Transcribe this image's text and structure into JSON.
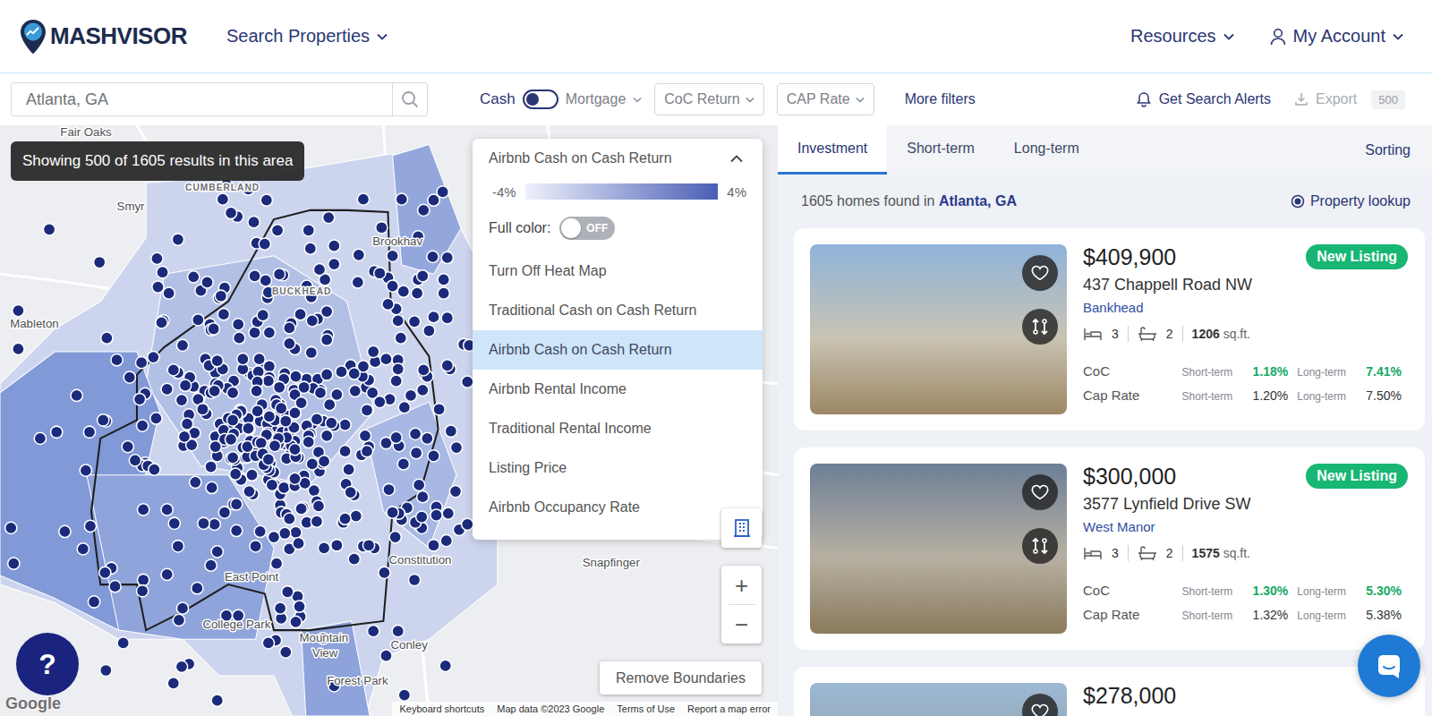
{
  "header": {
    "logo": "MASHVISOR",
    "menu": [
      {
        "label": "Search Properties"
      }
    ],
    "actions": [
      {
        "label": "Resources",
        "kind": "menu"
      },
      {
        "label": "My Account",
        "kind": "account"
      }
    ]
  },
  "filters": {
    "search": "Atlanta, GA",
    "cash": "Cash",
    "mortgage": "Mortgage",
    "mortgage_on": false,
    "selects": [
      "CoC Return",
      "CAP Rate"
    ],
    "more": "More filters",
    "alerts": "Get Search Alerts",
    "export": {
      "label": "Export",
      "count": "500",
      "disabled": true
    }
  },
  "map": {
    "results": "Showing 500 of 1605 results in this area",
    "labels": [
      {
        "text": "Fair Oaks",
        "kind": "place"
      },
      {
        "text": "CUMBERLAND",
        "kind": "district"
      },
      {
        "text": "Smyr",
        "kind": "place"
      },
      {
        "text": "Mableton",
        "kind": "place"
      },
      {
        "text": "BUCKHEAD",
        "kind": "district"
      },
      {
        "text": "Brookhav",
        "kind": "place"
      },
      {
        "text": "Snapfinger",
        "kind": "place"
      },
      {
        "text": "Constitution",
        "kind": "place"
      },
      {
        "text": "East Point",
        "kind": "place"
      },
      {
        "text": "College Park",
        "kind": "place"
      },
      {
        "text": "Conley",
        "kind": "place"
      },
      {
        "text": "Mountain",
        "kind": "place"
      },
      {
        "text": "View",
        "kind": "place"
      },
      {
        "text": "Forest Park",
        "kind": "place"
      }
    ],
    "google": "Google",
    "footer": [
      "Keyboard shortcuts",
      "Map data ©2023 Google",
      "Terms of Use",
      "Report a map error"
    ],
    "remove_boundaries": "Remove Boundaries",
    "zoom_in": "+",
    "zoom_out": "−",
    "help": "?"
  },
  "heatmap": {
    "title": "Airbnb Cash on Cash Return",
    "expanded": true,
    "min": "-4%",
    "max": "4%",
    "full_color": {
      "label": "Full color:",
      "on": false,
      "text": "OFF"
    },
    "options": [
      {
        "label": "Turn Off Heat Map",
        "selected": false
      },
      {
        "label": "Traditional Cash on Cash Return",
        "selected": false
      },
      {
        "label": "Airbnb Cash on Cash Return",
        "selected": true
      },
      {
        "label": "Airbnb Rental Income",
        "selected": false
      },
      {
        "label": "Traditional Rental Income",
        "selected": false
      },
      {
        "label": "Listing Price",
        "selected": false
      },
      {
        "label": "Airbnb Occupancy Rate",
        "selected": false
      }
    ]
  },
  "panel": {
    "tabs": [
      {
        "label": "Investment",
        "selected": true
      },
      {
        "label": "Short-term",
        "selected": false
      },
      {
        "label": "Long-term",
        "selected": false
      }
    ],
    "sorting": "Sorting",
    "summary": "1605 homes found in",
    "location": "Atlanta, GA",
    "lookup": "Property lookup",
    "listings": [
      {
        "price": "$409,900",
        "badge": "New Listing",
        "address": "437 Chappell Road NW",
        "area": "Bankhead",
        "beds": "3",
        "baths": "2",
        "sqft": "1206",
        "sqft_unit": "sq.ft.",
        "metrics": [
          {
            "label": "CoC",
            "short_label": "Short-term",
            "short": "1.18%",
            "long_label": "Long-term",
            "long": "7.41%",
            "highlight": true
          },
          {
            "label": "Cap Rate",
            "short_label": "Short-term",
            "short": "1.20%",
            "long_label": "Long-term",
            "long": "7.50%",
            "highlight": false
          }
        ]
      },
      {
        "price": "$300,000",
        "badge": "New Listing",
        "address": "3577 Lynfield Drive SW",
        "area": "West Manor",
        "beds": "3",
        "baths": "2",
        "sqft": "1575",
        "sqft_unit": "sq.ft.",
        "metrics": [
          {
            "label": "CoC",
            "short_label": "Short-term",
            "short": "1.30%",
            "long_label": "Long-term",
            "long": "5.30%",
            "highlight": true
          },
          {
            "label": "Cap Rate",
            "short_label": "Short-term",
            "short": "1.32%",
            "long_label": "Long-term",
            "long": "5.38%",
            "highlight": false
          }
        ]
      },
      {
        "price": "$278,000"
      }
    ]
  }
}
